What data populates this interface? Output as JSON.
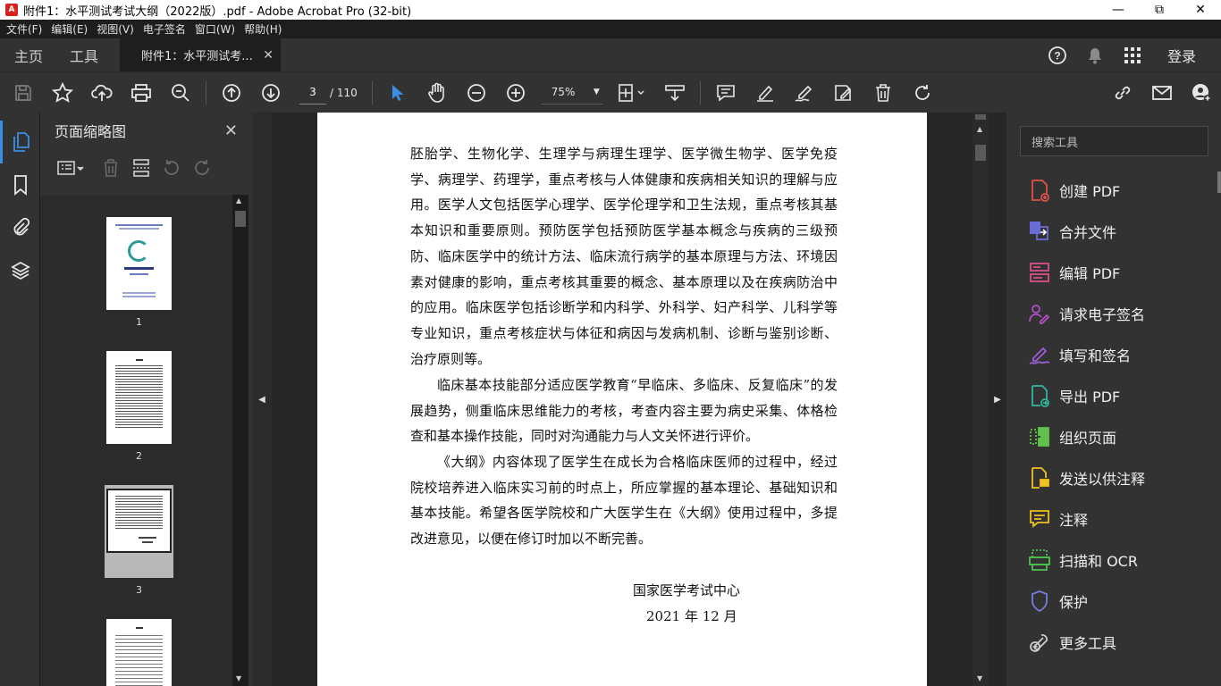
{
  "window": {
    "title": "附件1：水平测试考试大纲（2022版）.pdf - Adobe Acrobat Pro (32-bit)",
    "app_icon_text": "A"
  },
  "menu": [
    "文件(F)",
    "编辑(E)",
    "视图(V)",
    "电子签名",
    "窗口(W)",
    "帮助(H)"
  ],
  "tabs": {
    "home": "主页",
    "tools": "工具",
    "document": "附件1：水平测试考...",
    "login": "登录"
  },
  "toolbar": {
    "current_page": "3",
    "total_pages": "/ 110",
    "zoom": "75%"
  },
  "thumb_panel": {
    "title": "页面缩略图",
    "pages": [
      "1",
      "2",
      "3"
    ]
  },
  "document": {
    "paragraphs": [
      "胚胎学、生物化学、生理学与病理生理学、医学微生物学、医学免疫学、病理学、药理学，重点考核与人体健康和疾病相关知识的理解与应用。医学人文包括医学心理学、医学伦理学和卫生法规，重点考核其基本知识和重要原则。预防医学包括预防医学基本概念与疾病的三级预防、临床医学中的统计方法、临床流行病学的基本原理与方法、环境因素对健康的影响，重点考核其重要的概念、基本原理以及在疾病防治中的应用。临床医学包括诊断学和内科学、外科学、妇产科学、儿科学等专业知识，重点考核症状与体征和病因与发病机制、诊断与鉴别诊断、治疗原则等。",
      "临床基本技能部分适应医学教育“早临床、多临床、反复临床”的发展趋势，侧重临床思维能力的考核，考查内容主要为病史采集、体格检查和基本操作技能，同时对沟通能力与人文关怀进行评价。",
      "《大纲》内容体现了医学生在成长为合格临床医师的过程中，经过院校培养进入临床实习前的时点上，所应掌握的基本理论、基础知识和基本技能。希望各医学院校和广大医学生在《大纲》使用过程中，多提改进意见，以便在修订时加以不断完善。"
    ],
    "signature": "国家医学考试中心",
    "date": "2021 年 12 月"
  },
  "right_panel": {
    "search_placeholder": "搜索工具",
    "tools": [
      {
        "label": "创建 PDF",
        "icon": "create-pdf-icon",
        "color": "#e0524a"
      },
      {
        "label": "合并文件",
        "icon": "combine-files-icon",
        "color": "#6b6bd8"
      },
      {
        "label": "编辑 PDF",
        "icon": "edit-pdf-icon",
        "color": "#d94f8a"
      },
      {
        "label": "请求电子签名",
        "icon": "request-signature-icon",
        "color": "#b04fc4"
      },
      {
        "label": "填写和签名",
        "icon": "fill-sign-icon",
        "color": "#9b5fd6"
      },
      {
        "label": "导出 PDF",
        "icon": "export-pdf-icon",
        "color": "#2fb6a0"
      },
      {
        "label": "组织页面",
        "icon": "organize-pages-icon",
        "color": "#62c14c"
      },
      {
        "label": "发送以供注释",
        "icon": "send-comment-icon",
        "color": "#f0c020"
      },
      {
        "label": "注释",
        "icon": "comment-icon",
        "color": "#f0c020"
      },
      {
        "label": "扫描和 OCR",
        "icon": "scan-ocr-icon",
        "color": "#4cc24c"
      },
      {
        "label": "保护",
        "icon": "protect-icon",
        "color": "#7b7be0"
      },
      {
        "label": "更多工具",
        "icon": "more-tools-icon",
        "color": "#cccccc"
      }
    ]
  }
}
